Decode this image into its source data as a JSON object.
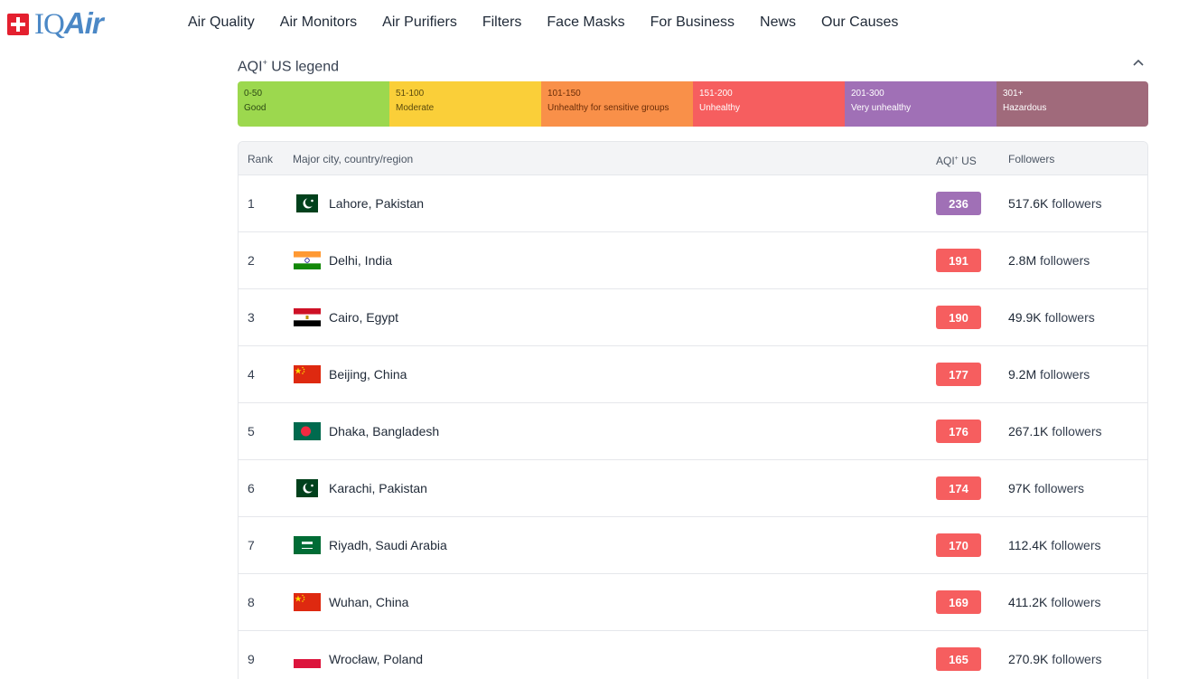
{
  "brand": {
    "logo_iq": "IQ",
    "logo_air": "Air"
  },
  "nav": [
    "Air Quality",
    "Air Monitors",
    "Air Purifiers",
    "Filters",
    "Face Masks",
    "For Business",
    "News",
    "Our Causes"
  ],
  "legend": {
    "title_prefix": "AQI",
    "title_sup": "+",
    "title_suffix": " US legend",
    "levels": [
      {
        "range": "0-50",
        "label": "Good",
        "color": "#9cd84e"
      },
      {
        "range": "51-100",
        "label": "Moderate",
        "color": "#facf39"
      },
      {
        "range": "101-150",
        "label": "Unhealthy for sensitive groups",
        "color": "#f99049"
      },
      {
        "range": "151-200",
        "label": "Unhealthy",
        "color": "#f65e5f"
      },
      {
        "range": "201-300",
        "label": "Very unhealthy",
        "color": "#a070b6"
      },
      {
        "range": "301+",
        "label": "Hazardous",
        "color": "#a06a7b"
      }
    ]
  },
  "table": {
    "headers": {
      "rank": "Rank",
      "city": "Major city, country/region",
      "aqi_prefix": "AQI",
      "aqi_sup": "+",
      "aqi_suffix": " US",
      "followers": "Followers"
    },
    "followers_word": "followers",
    "rows": [
      {
        "rank": "1",
        "flag": "pakistan-flag-icon",
        "city": "Lahore, Pakistan",
        "aqi": "236",
        "aqi_color": "#a070b6",
        "followers": "517.6K"
      },
      {
        "rank": "2",
        "flag": "india-flag-icon",
        "city": "Delhi, India",
        "aqi": "191",
        "aqi_color": "#f65e5f",
        "followers": "2.8M"
      },
      {
        "rank": "3",
        "flag": "egypt-flag-icon",
        "city": "Cairo, Egypt",
        "aqi": "190",
        "aqi_color": "#f65e5f",
        "followers": "49.9K"
      },
      {
        "rank": "4",
        "flag": "china-flag-icon",
        "city": "Beijing, China",
        "aqi": "177",
        "aqi_color": "#f65e5f",
        "followers": "9.2M"
      },
      {
        "rank": "5",
        "flag": "bangladesh-flag-icon",
        "city": "Dhaka, Bangladesh",
        "aqi": "176",
        "aqi_color": "#f65e5f",
        "followers": "267.1K"
      },
      {
        "rank": "6",
        "flag": "pakistan-flag-icon",
        "city": "Karachi, Pakistan",
        "aqi": "174",
        "aqi_color": "#f65e5f",
        "followers": "97K"
      },
      {
        "rank": "7",
        "flag": "saudi-arabia-flag-icon",
        "city": "Riyadh, Saudi Arabia",
        "aqi": "170",
        "aqi_color": "#f65e5f",
        "followers": "112.4K"
      },
      {
        "rank": "8",
        "flag": "china-flag-icon",
        "city": "Wuhan, China",
        "aqi": "169",
        "aqi_color": "#f65e5f",
        "followers": "411.2K"
      },
      {
        "rank": "9",
        "flag": "poland-flag-icon",
        "city": "Wrocław, Poland",
        "aqi": "165",
        "aqi_color": "#f65e5f",
        "followers": "270.9K"
      }
    ]
  }
}
